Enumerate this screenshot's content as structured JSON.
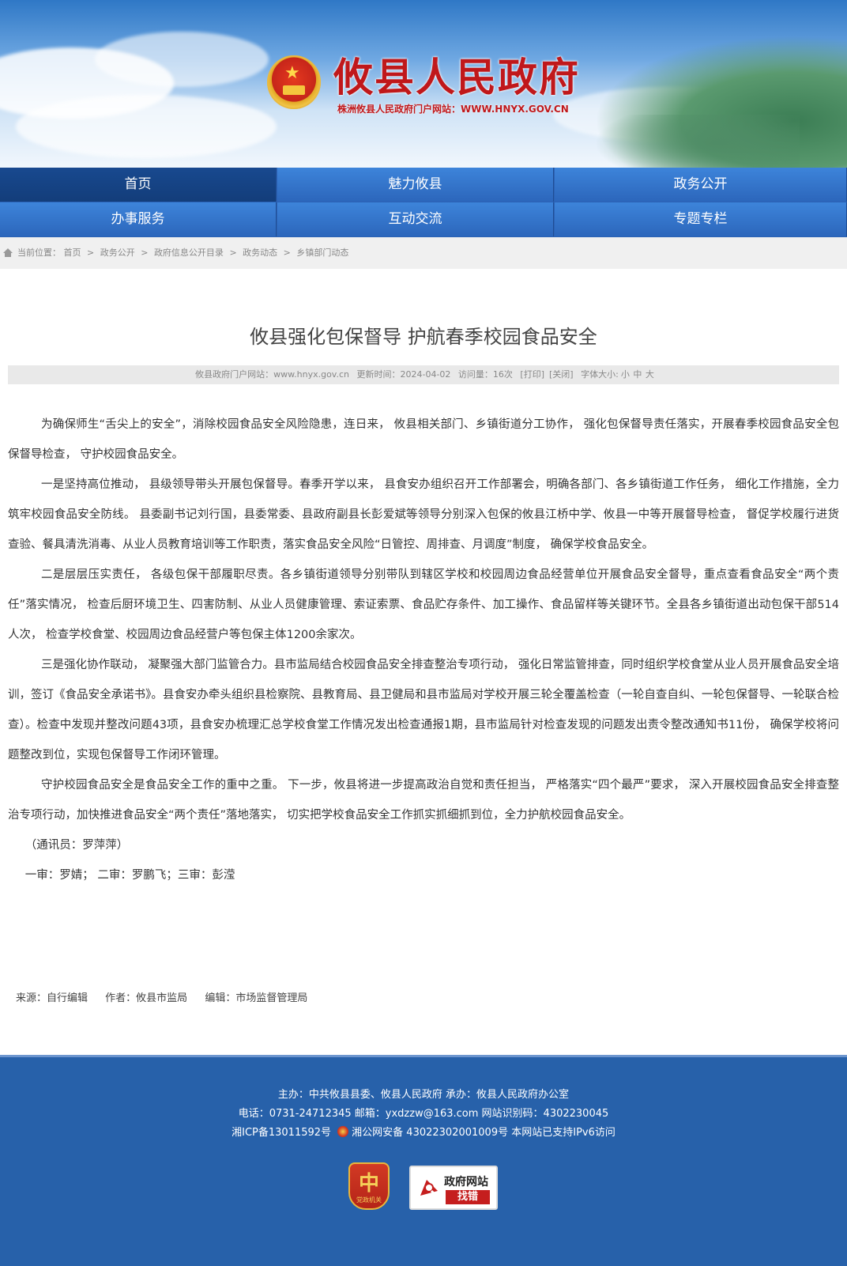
{
  "site": {
    "title": "攸县人民政府",
    "subtitle": "株洲攸县人民政府门户网站：WWW.HNYX.GOV.CN"
  },
  "nav": {
    "row1": [
      "首页",
      "魅力攸县",
      "政务公开"
    ],
    "row2": [
      "办事服务",
      "互动交流",
      "专题专栏"
    ],
    "active_index": 0
  },
  "breadcrumb": {
    "prefix": "当前位置：",
    "items": [
      "首页",
      "政务公开",
      "政府信息公开目录",
      "政务动态",
      "乡镇部门动态"
    ],
    "separator": ">"
  },
  "article": {
    "title": "攸县强化包保督导 护航春季校园食品安全",
    "meta": {
      "site": "攸县政府门户网站：www.hnyx.gov.cn",
      "updated": "更新时间：2024-04-02",
      "visits": "访问量：16次",
      "print": "[打印]",
      "close": "[关闭]",
      "font_label": "字体大小:",
      "font_small": "小",
      "font_medium": "中",
      "font_large": "大"
    },
    "paragraphs": [
      "为确保师生“舌尖上的安全”，消除校园食品安全风险隐患，连日来， 攸县相关部门、乡镇街道分工协作， 强化包保督导责任落实，开展春季校园食品安全包保督导检查， 守护校园食品安全。",
      "一是坚持高位推动， 县级领导带头开展包保督导。春季开学以来， 县食安办组织召开工作部署会，明确各部门、各乡镇街道工作任务， 细化工作措施，全力筑牢校园食品安全防线。 县委副书记刘行国，县委常委、县政府副县长彭爱斌等领导分别深入包保的攸县江桥中学、攸县一中等开展督导检查， 督促学校履行进货查验、餐具清洗消毒、从业人员教育培训等工作职责，落实食品安全风险“日管控、周排查、月调度”制度， 确保学校食品安全。",
      "二是层层压实责任， 各级包保干部履职尽责。各乡镇街道领导分别带队到辖区学校和校园周边食品经营单位开展食品安全督导，重点查看食品安全“两个责任”落实情况， 检查后厨环境卫生、四害防制、从业人员健康管理、索证索票、食品贮存条件、加工操作、食品留样等关键环节。全县各乡镇街道出动包保干部514人次， 检查学校食堂、校园周边食品经营户等包保主体1200余家次。",
      "三是强化协作联动， 凝聚强大部门监管合力。县市监局结合校园食品安全排查整治专项行动， 强化日常监管排查，同时组织学校食堂从业人员开展食品安全培训，签订《食品安全承诺书》。县食安办牵头组织县检察院、县教育局、县卫健局和县市监局对学校开展三轮全覆盖检查（一轮自查自纠、一轮包保督导、一轮联合检查）。检查中发现并整改问题43项，县食安办梳理汇总学校食堂工作情况发出检查通报1期，县市监局针对检查发现的问题发出责令整改通知书11份， 确保学校将问题整改到位，实现包保督导工作闭环管理。",
      "守护校园食品安全是食品安全工作的重中之重。 下一步，攸县将进一步提高政治自觉和责任担当， 严格落实“四个最严”要求， 深入开展校园食品安全排查整治专项行动，加快推进食品安全“两个责任”落地落实， 切实把学校食品安全工作抓实抓细抓到位，全力护航校园食品安全。"
    ],
    "reporter": "（通讯员：罗萍萍）",
    "review": "一审：罗婧； 二审：罗鹏飞；三审：彭滢",
    "source": "来源：自行编辑",
    "author": "作者：攸县市监局",
    "editor": "编辑：市场监督管理局"
  },
  "footer": {
    "line1": "主办：中共攸县县委、攸县人民政府 承办：攸县人民政府办公室",
    "line2": "电话：0731-24712345  邮箱：yxdzzw@163.com  网站识别码：4302230045",
    "icp": "湘ICP备13011592号",
    "police": "湘公网安备 43022302001009号",
    "ipv6": "本网站已支持IPv6访问",
    "party_glyph": "中",
    "party_caption": "党政机关",
    "fix_title": "政府网站",
    "fix_sub": "找错"
  },
  "colors": {
    "brand_red": "#c0181b",
    "nav_blue": "#2c66bb",
    "footer_blue": "#2761aa"
  }
}
